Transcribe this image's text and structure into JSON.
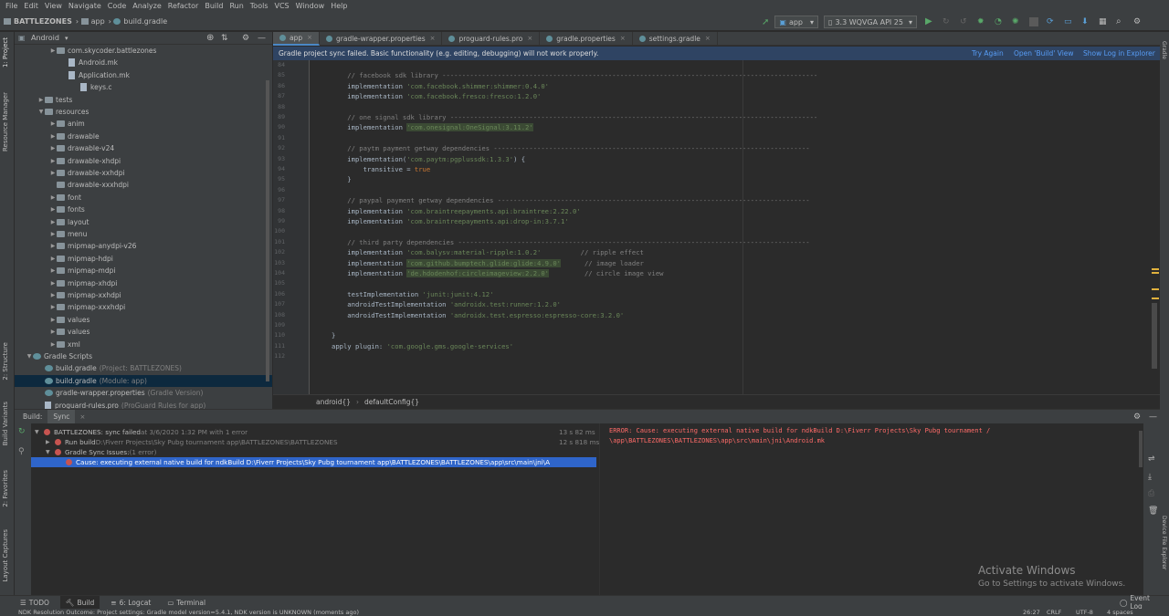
{
  "menubar": [
    "File",
    "Edit",
    "View",
    "Navigate",
    "Code",
    "Analyze",
    "Refactor",
    "Build",
    "Run",
    "Tools",
    "VCS",
    "Window",
    "Help"
  ],
  "navbar": {
    "project": "BATTLEZONES",
    "module": "app",
    "file": "build.gradle",
    "run_config": "app",
    "device": "3.3  WQVGA API 25"
  },
  "leftstrip": {
    "project": "1: Project",
    "resource_manager": "Resource Manager",
    "structure": "2: Structure",
    "build_variants": "Build Variants",
    "favorites": "2: Favorites",
    "layout_captures": "Layout Captures"
  },
  "project_panel": {
    "view_mode": "Android",
    "items": [
      {
        "text": "com.skycoder.battlezones",
        "indent": 1,
        "kind": "folder",
        "arrow": "▶",
        "note": ""
      },
      {
        "text": "Android.mk",
        "indent": 2,
        "kind": "file",
        "arrow": "",
        "note": ""
      },
      {
        "text": "Application.mk",
        "indent": 2,
        "kind": "file",
        "arrow": "",
        "note": ""
      },
      {
        "text": "keys.c",
        "indent": 3,
        "kind": "file",
        "arrow": "",
        "note": ""
      },
      {
        "text": "tests",
        "indent": 0,
        "kind": "folder",
        "arrow": "▶",
        "note": ""
      },
      {
        "text": "resources",
        "indent": 0,
        "kind": "folder",
        "arrow": "▼",
        "note": ""
      },
      {
        "text": "anim",
        "indent": 1,
        "kind": "folder",
        "arrow": "▶",
        "note": ""
      },
      {
        "text": "drawable",
        "indent": 1,
        "kind": "folder",
        "arrow": "▶",
        "note": ""
      },
      {
        "text": "drawable-v24",
        "indent": 1,
        "kind": "folder",
        "arrow": "▶",
        "note": ""
      },
      {
        "text": "drawable-xhdpi",
        "indent": 1,
        "kind": "folder",
        "arrow": "▶",
        "note": ""
      },
      {
        "text": "drawable-xxhdpi",
        "indent": 1,
        "kind": "folder",
        "arrow": "▶",
        "note": ""
      },
      {
        "text": "drawable-xxxhdpi",
        "indent": 1,
        "kind": "folder",
        "arrow": "",
        "note": ""
      },
      {
        "text": "font",
        "indent": 1,
        "kind": "folder",
        "arrow": "▶",
        "note": ""
      },
      {
        "text": "fonts",
        "indent": 1,
        "kind": "folder",
        "arrow": "▶",
        "note": ""
      },
      {
        "text": "layout",
        "indent": 1,
        "kind": "folder",
        "arrow": "▶",
        "note": ""
      },
      {
        "text": "menu",
        "indent": 1,
        "kind": "folder",
        "arrow": "▶",
        "note": ""
      },
      {
        "text": "mipmap-anydpi-v26",
        "indent": 1,
        "kind": "folder",
        "arrow": "▶",
        "note": ""
      },
      {
        "text": "mipmap-hdpi",
        "indent": 1,
        "kind": "folder",
        "arrow": "▶",
        "note": ""
      },
      {
        "text": "mipmap-mdpi",
        "indent": 1,
        "kind": "folder",
        "arrow": "▶",
        "note": ""
      },
      {
        "text": "mipmap-xhdpi",
        "indent": 1,
        "kind": "folder",
        "arrow": "▶",
        "note": ""
      },
      {
        "text": "mipmap-xxhdpi",
        "indent": 1,
        "kind": "folder",
        "arrow": "▶",
        "note": ""
      },
      {
        "text": "mipmap-xxxhdpi",
        "indent": 1,
        "kind": "folder",
        "arrow": "▶",
        "note": ""
      },
      {
        "text": "values",
        "indent": 1,
        "kind": "folder",
        "arrow": "▶",
        "note": ""
      },
      {
        "text": "values",
        "indent": 1,
        "kind": "folder",
        "arrow": "▶",
        "note": ""
      },
      {
        "text": "xml",
        "indent": 1,
        "kind": "folder",
        "arrow": "▶",
        "note": ""
      },
      {
        "text": "Gradle Scripts",
        "indent": -1,
        "kind": "gradle",
        "arrow": "▼",
        "note": ""
      },
      {
        "text": "build.gradle",
        "indent": 0,
        "kind": "gradle",
        "arrow": "",
        "note": "(Project: BATTLEZONES)"
      },
      {
        "text": "build.gradle",
        "indent": 0,
        "kind": "gradle",
        "arrow": "",
        "note": "(Module: app)",
        "selected": true
      },
      {
        "text": "gradle-wrapper.properties",
        "indent": 0,
        "kind": "gradle",
        "arrow": "",
        "note": "(Gradle Version)"
      },
      {
        "text": "proguard-rules.pro",
        "indent": 0,
        "kind": "file",
        "arrow": "",
        "note": "(ProGuard Rules for app)"
      }
    ]
  },
  "tabs": [
    {
      "label": "app",
      "active": true
    },
    {
      "label": "gradle-wrapper.properties",
      "active": false
    },
    {
      "label": "proguard-rules.pro",
      "active": false
    },
    {
      "label": "gradle.properties",
      "active": false
    },
    {
      "label": "settings.gradle",
      "active": false
    }
  ],
  "banner": {
    "message": "Gradle project sync failed. Basic functionality (e.g. editing, debugging) will not work properly.",
    "try_again": "Try Again",
    "open_build_view": "Open 'Build' View",
    "show_log": "Show Log in Explorer"
  },
  "editor": {
    "lines": [
      {
        "n": "84",
        "segs": []
      },
      {
        "n": "85",
        "segs": [
          [
            "cm",
            "    // facebook sdk library -----------------------------------------------------------------------------------------------"
          ]
        ]
      },
      {
        "n": "86",
        "segs": [
          [
            "",
            "    implementation "
          ],
          [
            "str",
            "'com.facebook.shimmer:shimmer:0.4.0'"
          ]
        ]
      },
      {
        "n": "87",
        "segs": [
          [
            "",
            "    implementation "
          ],
          [
            "str",
            "'com.facebook.fresco:fresco:1.2.0'"
          ]
        ]
      },
      {
        "n": "88",
        "segs": []
      },
      {
        "n": "89",
        "segs": [
          [
            "cm",
            "    // one signal sdk library ---------------------------------------------------------------------------------------------"
          ]
        ]
      },
      {
        "n": "90",
        "segs": [
          [
            "",
            "    implementation "
          ],
          [
            "str hl",
            "'com.onesignal:OneSignal:3.11.2'"
          ]
        ]
      },
      {
        "n": "91",
        "segs": []
      },
      {
        "n": "92",
        "segs": [
          [
            "cm",
            "    // paytm payment getway dependencies --------------------------------------------------------------------------------"
          ]
        ]
      },
      {
        "n": "93",
        "segs": [
          [
            "",
            "    implementation("
          ],
          [
            "str",
            "'com.paytm:pgplussdk:1.3.3'"
          ],
          [
            "",
            ") {"
          ]
        ]
      },
      {
        "n": "94",
        "segs": [
          [
            "",
            "        transitive = "
          ],
          [
            "kw",
            "true"
          ]
        ]
      },
      {
        "n": "95",
        "segs": [
          [
            "",
            "    }"
          ]
        ]
      },
      {
        "n": "96",
        "segs": []
      },
      {
        "n": "97",
        "segs": [
          [
            "cm",
            "    // paypal payment getway dependencies -------------------------------------------------------------------------------"
          ]
        ]
      },
      {
        "n": "98",
        "segs": [
          [
            "",
            "    implementation "
          ],
          [
            "str",
            "'com.braintreepayments.api:braintree:2.22.0'"
          ]
        ]
      },
      {
        "n": "99",
        "segs": [
          [
            "",
            "    implementation "
          ],
          [
            "str",
            "'com.braintreepayments.api:drop-in:3.7.1'"
          ]
        ]
      },
      {
        "n": "100",
        "segs": []
      },
      {
        "n": "101",
        "segs": [
          [
            "cm",
            "    // third party dependencies -----------------------------------------------------------------------------------------"
          ]
        ]
      },
      {
        "n": "102",
        "segs": [
          [
            "",
            "    implementation "
          ],
          [
            "str",
            "'com.balysv:material-ripple:1.0.2'"
          ],
          [
            "cm",
            "          // ripple effect"
          ]
        ]
      },
      {
        "n": "103",
        "segs": [
          [
            "",
            "    implementation "
          ],
          [
            "str hl",
            "'com.github.bumptech.glide:glide:4.9.0'"
          ],
          [
            "cm",
            "      // image loader"
          ]
        ]
      },
      {
        "n": "104",
        "segs": [
          [
            "",
            "    implementation "
          ],
          [
            "str hl",
            "'de.hdodenhof:circleimageview:2.2.0'"
          ],
          [
            "cm",
            "         // circle image view"
          ]
        ]
      },
      {
        "n": "105",
        "segs": []
      },
      {
        "n": "106",
        "segs": [
          [
            "",
            "    testImplementation "
          ],
          [
            "str",
            "'junit:junit:4.12'"
          ]
        ]
      },
      {
        "n": "107",
        "segs": [
          [
            "",
            "    androidTestImplementation "
          ],
          [
            "str",
            "'androidx.test:runner:1.2.0'"
          ]
        ]
      },
      {
        "n": "108",
        "segs": [
          [
            "",
            "    androidTestImplementation "
          ],
          [
            "str",
            "'androidx.test.espresso:espresso-core:3.2.0'"
          ]
        ]
      },
      {
        "n": "109",
        "segs": []
      },
      {
        "n": "110",
        "segs": [
          [
            "",
            "}"
          ]
        ]
      },
      {
        "n": "111",
        "segs": [
          [
            "",
            "apply plugin: "
          ],
          [
            "str",
            "'com.google.gms.google-services'"
          ]
        ]
      },
      {
        "n": "112",
        "segs": []
      }
    ],
    "breadcrumb_1": "android{}",
    "breadcrumb_2": "defaultConfig{}"
  },
  "build_panel": {
    "tab_build": "Build:",
    "tab_sync": "Sync",
    "items": [
      {
        "text": "BATTLEZONES: sync failed",
        "grey": " at 3/6/2020 1:32 PM  with 1 error",
        "time": "13 s 82 ms",
        "indent": 0,
        "arrow": "▼"
      },
      {
        "text": "Run build",
        "grey": " D:\\Fiverr Projects\\Sky Pubg tournament app\\BATTLEZONES\\BATTLEZONES",
        "time": "12 s 818 ms",
        "indent": 1,
        "arrow": "▶"
      },
      {
        "text": "Gradle Sync Issues:",
        "grey": " (1 error)",
        "time": "",
        "indent": 1,
        "arrow": "▼"
      },
      {
        "text": "Cause: executing external native build for ndkBuild D:\\Fiverr Projects\\Sky Pubg tournament app\\BATTLEZONES\\BATTLEZONES\\app\\src\\main\\jni\\A",
        "grey": "",
        "time": "",
        "indent": 2,
        "arrow": "",
        "selected": true
      }
    ],
    "console_line1": "ERROR: Cause: executing external native build for ndkBuild D:\\Fiverr Projects\\Sky Pubg tournament /",
    "console_line2": "\\app\\BATTLEZONES\\BATTLEZONES\\app\\src\\main\\jni\\Android.mk"
  },
  "bottom_tabs": {
    "todo": "TODO",
    "build": "Build",
    "logcat": "6: Logcat",
    "terminal": "Terminal",
    "event_log": "Event Log"
  },
  "status": {
    "message": "NDK Resolution Outcome: Project settings: Gradle model version=5.4.1, NDK version is UNKNOWN (moments ago)",
    "position": "26:27",
    "line_sep": "CRLF",
    "encoding": "UTF-8",
    "indent": "4 spaces"
  },
  "watermark": {
    "line1": "Activate Windows",
    "line2": "Go to Settings to activate Windows."
  },
  "rightstrip": {
    "gradle": "Gradle",
    "device_file_explorer": "Device File Explorer"
  }
}
